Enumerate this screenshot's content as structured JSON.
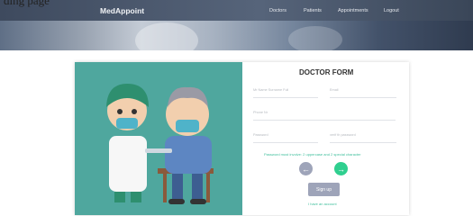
{
  "page": {
    "top_left_text": "ding page"
  },
  "nav": {
    "brand": "MedAppoint",
    "items": [
      {
        "label": "Doctors"
      },
      {
        "label": "Patients"
      },
      {
        "label": "Appointments"
      },
      {
        "label": "Logout"
      }
    ]
  },
  "form": {
    "title": "DOCTOR FORM",
    "fields": {
      "full_name": "Mr Name Surname Full",
      "email": "Email",
      "phone": "Phone Nr",
      "password": "Password",
      "confirm_password": "verif th password"
    },
    "password_hint": "Password must involve: 2 uppercase and 2 special character",
    "signup_label": "Sign up",
    "have_account_label": "I have an account"
  },
  "colors": {
    "accent": "#3fbf9c",
    "illustration_bg": "#4fa79e",
    "signup_button": "#9ea4b9"
  }
}
